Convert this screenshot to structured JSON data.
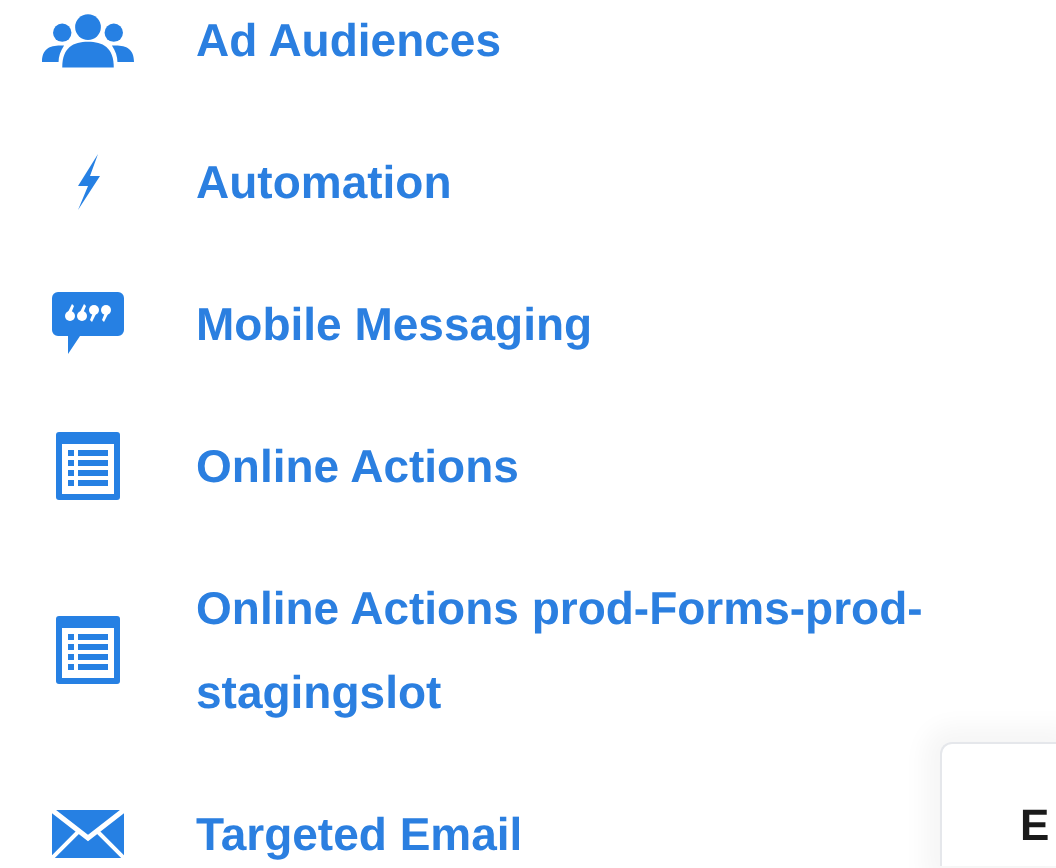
{
  "menu": [
    {
      "kind": "users",
      "label": "Ad Audiences"
    },
    {
      "kind": "bolt",
      "label": "Automation"
    },
    {
      "kind": "quote",
      "label": "Mobile Messaging"
    },
    {
      "kind": "list",
      "label": "Online Actions"
    },
    {
      "kind": "list",
      "label": "Online Actions prod-Forms-prod-stagingslot"
    },
    {
      "kind": "mail",
      "label": "Targeted Email"
    }
  ],
  "card": {
    "title": "E"
  }
}
